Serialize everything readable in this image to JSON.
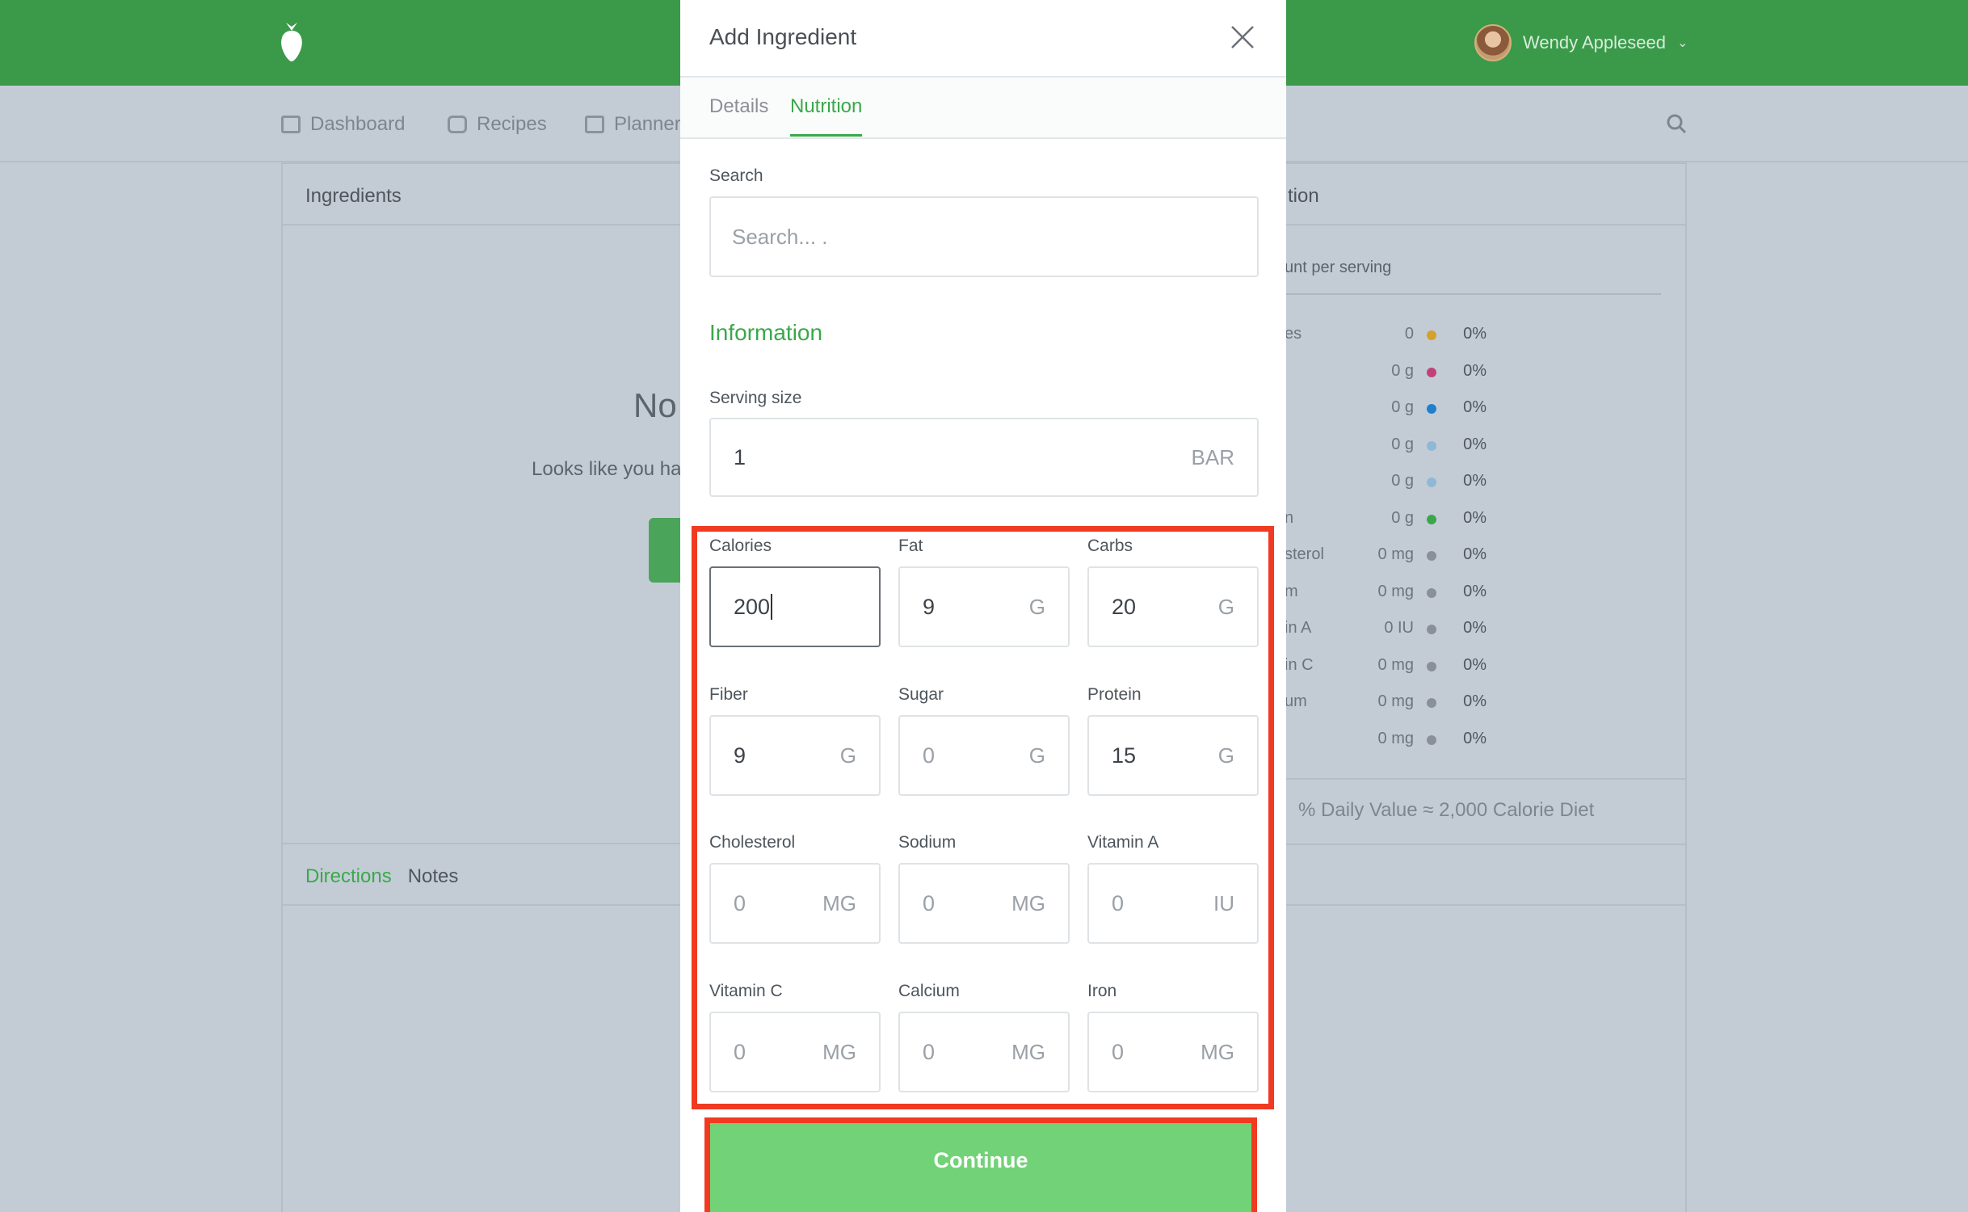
{
  "header": {
    "user_name": "Wendy Appleseed",
    "user_chevron": "⌄"
  },
  "nav": {
    "items": [
      {
        "label": "Dashboard",
        "icon": "dashboard-icon"
      },
      {
        "label": "Recipes",
        "icon": "inbox-icon"
      },
      {
        "label": "Planner",
        "icon": "calendar-icon"
      }
    ]
  },
  "background": {
    "ingredients_title": "Ingredients",
    "empty_heading": "No",
    "empty_text": "Looks like you ha",
    "nutrition_title": "tion",
    "amount_per_serving": "unt per serving",
    "directions_tab": "Directions",
    "notes_tab": "Notes",
    "daily_value_note": "% Daily Value ≈ 2,000 Calorie Diet",
    "nutrition_rows": [
      {
        "label": "es",
        "amount": "0",
        "pct": "0%",
        "color": "#d4a12a"
      },
      {
        "label": "",
        "amount": "0 g",
        "pct": "0%",
        "color": "#c2407a"
      },
      {
        "label": "",
        "amount": "0 g",
        "pct": "0%",
        "color": "#1e7fd0"
      },
      {
        "label": "",
        "amount": "0 g",
        "pct": "0%",
        "color": "#8fb8d6"
      },
      {
        "label": "",
        "amount": "0 g",
        "pct": "0%",
        "color": "#8fb8d6"
      },
      {
        "label": "n",
        "amount": "0 g",
        "pct": "0%",
        "color": "#3aa84a"
      },
      {
        "label": "sterol",
        "amount": "0 mg",
        "pct": "0%",
        "color": "#8a9097"
      },
      {
        "label": "m",
        "amount": "0 mg",
        "pct": "0%",
        "color": "#8a9097"
      },
      {
        "label": "in A",
        "amount": "0 IU",
        "pct": "0%",
        "color": "#8a9097"
      },
      {
        "label": "in C",
        "amount": "0 mg",
        "pct": "0%",
        "color": "#8a9097"
      },
      {
        "label": "um",
        "amount": "0 mg",
        "pct": "0%",
        "color": "#8a9097"
      },
      {
        "label": "",
        "amount": "0 mg",
        "pct": "0%",
        "color": "#8a9097"
      }
    ]
  },
  "modal": {
    "title": "Add Ingredient",
    "tabs": {
      "details": "Details",
      "nutrition": "Nutrition"
    },
    "search": {
      "label": "Search",
      "placeholder": "Search...         ."
    },
    "information_title": "Information",
    "serving": {
      "label": "Serving size",
      "value": "1",
      "unit": "BAR"
    },
    "fields": [
      {
        "label": "Calories",
        "value": "200",
        "unit": "",
        "placeholder": false,
        "active": true
      },
      {
        "label": "Fat",
        "value": "9",
        "unit": "G",
        "placeholder": false
      },
      {
        "label": "Carbs",
        "value": "20",
        "unit": "G",
        "placeholder": false
      },
      {
        "label": "Fiber",
        "value": "9",
        "unit": "G",
        "placeholder": false
      },
      {
        "label": "Sugar",
        "value": "0",
        "unit": "G",
        "placeholder": true
      },
      {
        "label": "Protein",
        "value": "15",
        "unit": "G",
        "placeholder": false
      },
      {
        "label": "Cholesterol",
        "value": "0",
        "unit": "MG",
        "placeholder": true
      },
      {
        "label": "Sodium",
        "value": "0",
        "unit": "MG",
        "placeholder": true
      },
      {
        "label": "Vitamin A",
        "value": "0",
        "unit": "IU",
        "placeholder": true
      },
      {
        "label": "Vitamin C",
        "value": "0",
        "unit": "MG",
        "placeholder": true
      },
      {
        "label": "Calcium",
        "value": "0",
        "unit": "MG",
        "placeholder": true
      },
      {
        "label": "Iron",
        "value": "0",
        "unit": "MG",
        "placeholder": true
      }
    ],
    "continue_label": "Continue"
  },
  "colors": {
    "brand_green": "#3a9a4a",
    "accent_green": "#3aa84a",
    "button_green": "#72d277",
    "highlight_red": "#f03a21"
  }
}
